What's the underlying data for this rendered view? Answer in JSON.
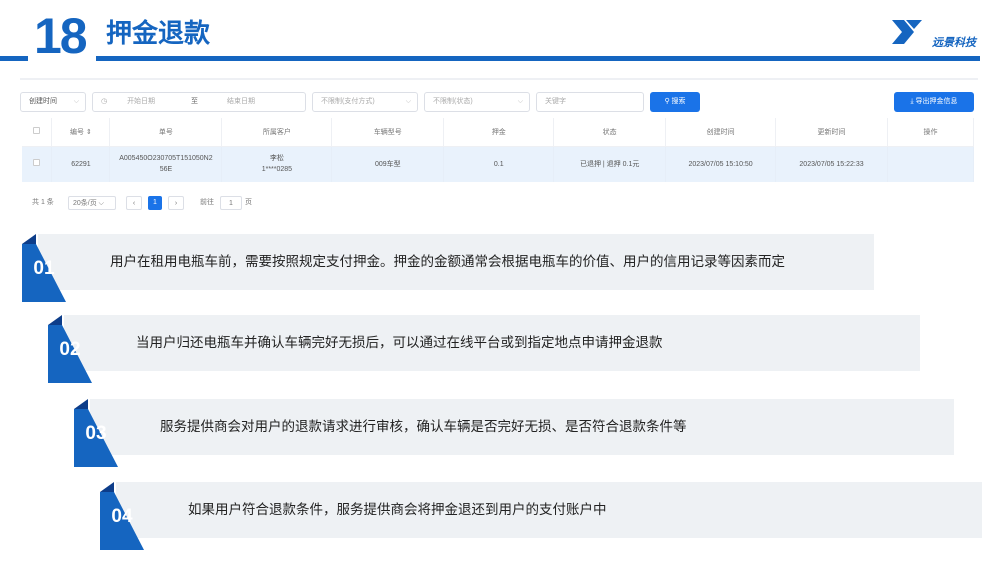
{
  "header": {
    "number": "18",
    "title": "押金退款",
    "logo_text": "远景科技"
  },
  "filters": {
    "type_select": "创建时间",
    "start_date": "开始日期",
    "separator": "至",
    "end_date": "结束日期",
    "pay_method": "不限制(支付方式)",
    "status": "不限制(状态)",
    "keyword": "关键字",
    "search_button": "搜索",
    "export_button": "导出押金信息"
  },
  "table": {
    "headers": [
      "编号",
      "单号",
      "所属客户",
      "车辆型号",
      "押金",
      "状态",
      "创建时间",
      "更新时间",
      "操作"
    ],
    "rows": [
      {
        "id": "62291",
        "order_line1": "A005450O230705T151050N2",
        "order_line2": "56E",
        "customer_name": "李松",
        "customer_phone": "1****0285",
        "model": "009车型",
        "deposit": "0.1",
        "status": "已退押 | 退押 0.1元",
        "created": "2023/07/05 15:10:50",
        "updated": "2023/07/05 15:22:33"
      }
    ]
  },
  "pagination": {
    "total": "共 1 条",
    "page_size": "20条/页",
    "current": "1",
    "goto_label": "前往",
    "goto_value": "1",
    "page_unit": "页"
  },
  "steps": [
    {
      "num": "01",
      "text": "用户在租用电瓶车前，需要按照规定支付押金。押金的金额通常会根据电瓶车的价值、用户的信用记录等因素而定"
    },
    {
      "num": "02",
      "text": "当用户归还电瓶车并确认车辆完好无损后，可以通过在线平台或到指定地点申请押金退款"
    },
    {
      "num": "03",
      "text": "服务提供商会对用户的退款请求进行审核，确认车辆是否完好无损、是否符合退款条件等"
    },
    {
      "num": "04",
      "text": "如果用户符合退款条件，服务提供商会将押金退还到用户的支付账户中"
    }
  ],
  "colors": {
    "accent": "#1565c0",
    "button": "#1a73e8",
    "row_highlight": "#e9f2fc",
    "step_bg": "#eef1f4"
  }
}
